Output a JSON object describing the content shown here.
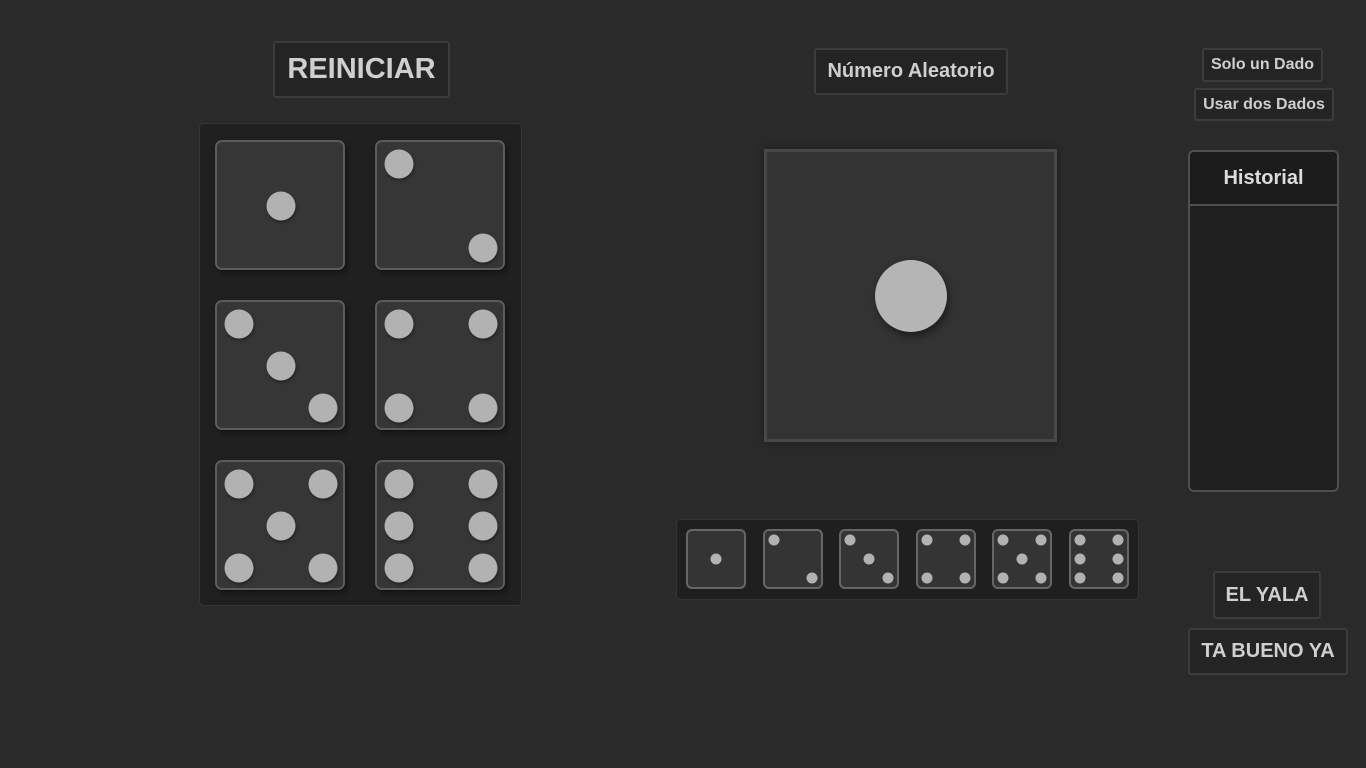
{
  "buttons": {
    "reset": "REINICIAR",
    "random_number": "Número Aleatorio",
    "one_die": "Solo un Dado",
    "two_dice": "Usar dos Dados",
    "yala": "EL YALA",
    "bueno": "TA BUENO YA"
  },
  "dice_faces": [
    1,
    2,
    3,
    4,
    5,
    6
  ],
  "current_roll": 1,
  "history": {
    "title": "Historial",
    "entries": []
  },
  "colors": {
    "background": "#2a2a2a",
    "die_face": "#363636",
    "pip": "#b2b2b2",
    "border": "#5c5c5c"
  }
}
